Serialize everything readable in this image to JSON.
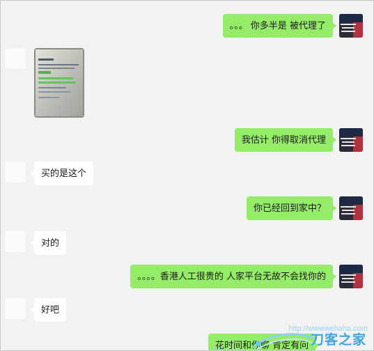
{
  "chat": {
    "messages": [
      {
        "side": "right",
        "text": "。。。 你多半是 被代理了"
      },
      {
        "side": "left",
        "type": "image"
      },
      {
        "side": "right",
        "text": "我估计 你得取消代理"
      },
      {
        "side": "left",
        "text": "买的是这个"
      },
      {
        "side": "right",
        "text": "你已经回到家中？"
      },
      {
        "side": "left",
        "text": "对的"
      },
      {
        "side": "right",
        "text": "。。。。香港人工很贵的  人家平台无故不会找你的"
      },
      {
        "side": "left",
        "text": "好吧"
      },
      {
        "side": "right",
        "text": "花时间和你聊 肯定有问"
      }
    ]
  },
  "watermark": {
    "url": "http://wwwwehaha.com",
    "logo_text": "刀客之家"
  },
  "colors": {
    "background": "#f2f2f2",
    "sent_bubble": "#95ec69",
    "received_bubble": "#ffffff",
    "watermark": "#3aa6dd"
  }
}
